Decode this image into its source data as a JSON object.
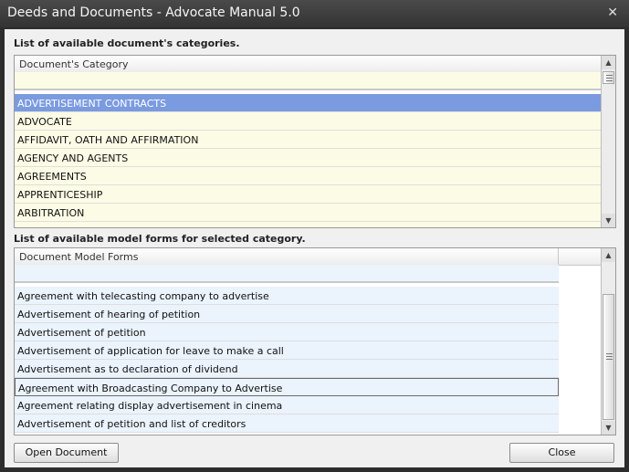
{
  "window": {
    "title": "Deeds and Documents - Advocate Manual 5.0",
    "close_glyph": "✕"
  },
  "categories": {
    "label": "List of available document's categories.",
    "column_header": "Document's Category",
    "filter_value": "",
    "rows": [
      "ADVERTISEMENT CONTRACTS",
      "ADVOCATE",
      "AFFIDAVIT, OATH AND AFFIRMATION",
      "AGENCY AND AGENTS",
      "AGREEMENTS",
      "APPRENTICESHIP",
      "ARBITRATION"
    ],
    "selected_index": 0,
    "colors": {
      "row_bg": "#fcfce6",
      "selected_bg": "#7b9be0"
    }
  },
  "forms": {
    "label": "List of available model forms for selected category.",
    "column_header": "Document Model Forms",
    "filter_value": "",
    "rows": [
      "Agreement with telecasting company to advertise",
      "Advertisement of hearing of petition",
      "Advertisement of petition",
      "Advertisement of application for leave to make a call",
      "Advertisement as to declaration of dividend",
      "Agreement with Broadcasting Company to Advertise",
      "Agreement relating display advertisement in cinema",
      "Advertisement of petition and list of creditors"
    ],
    "focused_index": 5,
    "colors": {
      "row_bg": "#ebf3fd"
    }
  },
  "buttons": {
    "open": "Open Document",
    "close": "Close"
  },
  "icons": {
    "up": "▲",
    "down": "▼"
  }
}
